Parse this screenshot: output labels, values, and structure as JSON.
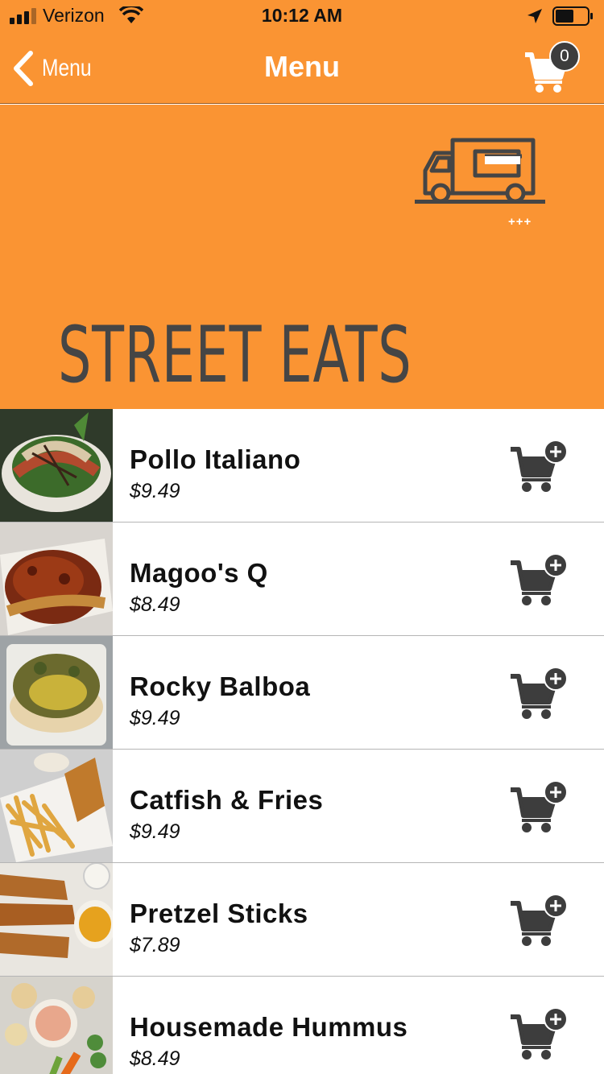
{
  "status_bar": {
    "carrier": "Verizon",
    "time": "10:12 AM"
  },
  "nav": {
    "back_label": "Menu",
    "title": "Menu",
    "cart_count": "0"
  },
  "hero": {
    "truck_tag": "+++",
    "title": "STREET EATS"
  },
  "colors": {
    "brand": "#FA9433",
    "icon_dark": "#3d3d3d"
  },
  "menu_items": [
    {
      "name": "Pollo Italiano",
      "price": "$9.49"
    },
    {
      "name": "Magoo's Q",
      "price": "$8.49"
    },
    {
      "name": "Rocky Balboa",
      "price": "$9.49"
    },
    {
      "name": "Catfish & Fries",
      "price": "$9.49"
    },
    {
      "name": "Pretzel Sticks",
      "price": "$7.89"
    },
    {
      "name": "Housemade Hummus",
      "price": "$8.49"
    }
  ]
}
